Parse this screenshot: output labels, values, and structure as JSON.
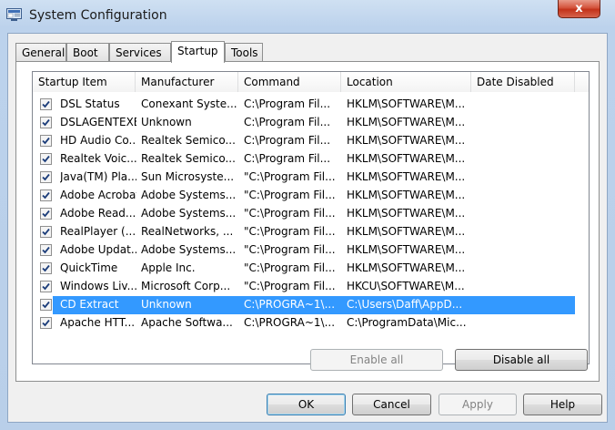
{
  "window": {
    "title": "System Configuration",
    "close_label": "x"
  },
  "tabs": [
    {
      "label": "General"
    },
    {
      "label": "Boot"
    },
    {
      "label": "Services"
    },
    {
      "label": "Startup",
      "active": true
    },
    {
      "label": "Tools"
    }
  ],
  "columns": [
    "Startup Item",
    "Manufacturer",
    "Command",
    "Location",
    "Date Disabled"
  ],
  "rows": [
    {
      "checked": true,
      "item": "DSL Status",
      "manufacturer": "Conexant Syste...",
      "command": "C:\\Program Fil...",
      "location": "HKLM\\SOFTWARE\\M...",
      "date_disabled": ""
    },
    {
      "checked": true,
      "item": "DSLAGENTEXE",
      "manufacturer": "Unknown",
      "command": "C:\\Program Fil...",
      "location": "HKLM\\SOFTWARE\\M...",
      "date_disabled": ""
    },
    {
      "checked": true,
      "item": "HD Audio Co...",
      "manufacturer": "Realtek Semico...",
      "command": "C:\\Program Fil...",
      "location": "HKLM\\SOFTWARE\\M...",
      "date_disabled": ""
    },
    {
      "checked": true,
      "item": "Realtek Voic...",
      "manufacturer": "Realtek Semico...",
      "command": "C:\\Program Fil...",
      "location": "HKLM\\SOFTWARE\\M...",
      "date_disabled": ""
    },
    {
      "checked": true,
      "item": "Java(TM) Pla...",
      "manufacturer": "Sun Microsyste...",
      "command": "\"C:\\Program Fil...",
      "location": "HKLM\\SOFTWARE\\M...",
      "date_disabled": ""
    },
    {
      "checked": true,
      "item": "Adobe Acrobat",
      "manufacturer": "Adobe Systems...",
      "command": "\"C:\\Program Fil...",
      "location": "HKLM\\SOFTWARE\\M...",
      "date_disabled": ""
    },
    {
      "checked": true,
      "item": "Adobe Read...",
      "manufacturer": "Adobe Systems...",
      "command": "\"C:\\Program Fil...",
      "location": "HKLM\\SOFTWARE\\M...",
      "date_disabled": ""
    },
    {
      "checked": true,
      "item": "RealPlayer (...",
      "manufacturer": "RealNetworks, ...",
      "command": "\"C:\\Program Fil...",
      "location": "HKLM\\SOFTWARE\\M...",
      "date_disabled": ""
    },
    {
      "checked": true,
      "item": "Adobe Updat...",
      "manufacturer": "Adobe Systems...",
      "command": "\"C:\\Program Fil...",
      "location": "HKLM\\SOFTWARE\\M...",
      "date_disabled": ""
    },
    {
      "checked": true,
      "item": "QuickTime",
      "manufacturer": "Apple Inc.",
      "command": "\"C:\\Program Fil...",
      "location": "HKLM\\SOFTWARE\\M...",
      "date_disabled": ""
    },
    {
      "checked": true,
      "item": "Windows Liv...",
      "manufacturer": "Microsoft Corp...",
      "command": "\"C:\\Program Fil...",
      "location": "HKCU\\SOFTWARE\\M...",
      "date_disabled": ""
    },
    {
      "checked": true,
      "selected": true,
      "item": "CD Extract",
      "manufacturer": "Unknown",
      "command": "C:\\PROGRA~1\\...",
      "location": "C:\\Users\\Daff\\AppD...",
      "date_disabled": ""
    },
    {
      "checked": true,
      "item": "Apache HTT...",
      "manufacturer": "Apache Softwa...",
      "command": "C:\\PROGRA~1\\...",
      "location": "C:\\ProgramData\\Mic...",
      "date_disabled": ""
    }
  ],
  "buttons": {
    "enable_all": "Enable all",
    "disable_all": "Disable all",
    "ok": "OK",
    "cancel": "Cancel",
    "apply": "Apply",
    "help": "Help"
  },
  "icons": {
    "app": "msconfig-icon",
    "close": "close-icon",
    "checkbox": "checkmark-icon"
  },
  "colors": {
    "selection": "#3399ff",
    "close_button": "#c3321a",
    "window_frame": "#b9cfe9"
  }
}
